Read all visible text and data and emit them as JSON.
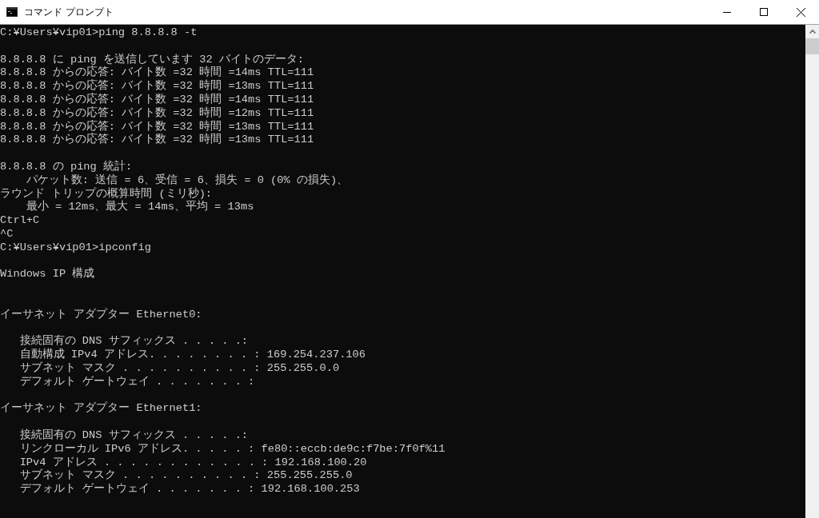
{
  "window": {
    "title": "コマンド プロンプト"
  },
  "console": {
    "lines": [
      {
        "text": "C:¥Users¥vip01>ping 8.8.8.8 -t"
      },
      {
        "kind": "blank"
      },
      {
        "text": "8.8.8.8 に ping を送信しています 32 バイトのデータ:"
      },
      {
        "text": "8.8.8.8 からの応答: バイト数 =32 時間 =14ms TTL=111"
      },
      {
        "text": "8.8.8.8 からの応答: バイト数 =32 時間 =13ms TTL=111"
      },
      {
        "text": "8.8.8.8 からの応答: バイト数 =32 時間 =14ms TTL=111"
      },
      {
        "text": "8.8.8.8 からの応答: バイト数 =32 時間 =12ms TTL=111"
      },
      {
        "text": "8.8.8.8 からの応答: バイト数 =32 時間 =13ms TTL=111"
      },
      {
        "text": "8.8.8.8 からの応答: バイト数 =32 時間 =13ms TTL=111"
      },
      {
        "kind": "blank"
      },
      {
        "text": "8.8.8.8 の ping 統計:"
      },
      {
        "text": "    パケット数: 送信 = 6、受信 = 6、損失 = 0 (0% の損失)、"
      },
      {
        "text": "ラウンド トリップの概算時間 (ミリ秒):"
      },
      {
        "text": "    最小 = 12ms、最大 = 14ms、平均 = 13ms"
      },
      {
        "text": "Ctrl+C"
      },
      {
        "text": "^C"
      },
      {
        "text": "C:¥Users¥vip01>ipconfig"
      },
      {
        "kind": "blank"
      },
      {
        "text": "Windows IP 構成"
      },
      {
        "kind": "blank"
      },
      {
        "kind": "blank"
      },
      {
        "text": "イーサネット アダプター Ethernet0:"
      },
      {
        "kind": "blank"
      },
      {
        "text": "   接続固有の DNS サフィックス . . . . .:"
      },
      {
        "text": "   自動構成 IPv4 アドレス. . . . . . . . : 169.254.237.106"
      },
      {
        "text": "   サブネット マスク . . . . . . . . . . : 255.255.0.0"
      },
      {
        "text": "   デフォルト ゲートウェイ . . . . . . . :"
      },
      {
        "kind": "blank"
      },
      {
        "text": "イーサネット アダプター Ethernet1:"
      },
      {
        "kind": "blank"
      },
      {
        "text": "   接続固有の DNS サフィックス . . . . .:"
      },
      {
        "text": "   リンクローカル IPv6 アドレス. . . . . : fe80::eccb:de9c:f7be:7f0f%11"
      },
      {
        "text": "   IPv4 アドレス . . . . . . . . . . . . : 192.168.100.20"
      },
      {
        "text": "   サブネット マスク . . . . . . . . . . : 255.255.255.0"
      },
      {
        "text": "   デフォルト ゲートウェイ . . . . . . . : 192.168.100.253"
      }
    ]
  }
}
